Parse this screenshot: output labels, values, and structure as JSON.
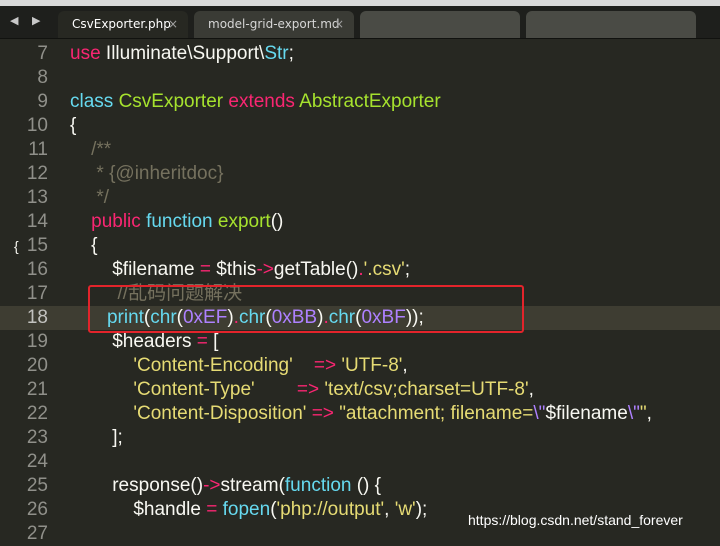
{
  "tabs": [
    {
      "label": "CsvExporter.php",
      "close": "×",
      "active": true
    },
    {
      "label": "model-grid-export.md",
      "close": "×",
      "active": false
    }
  ],
  "nav_arrows": "◀ ▶",
  "fold_marker": "{",
  "watermark": "https://blog.csdn.net/stand_forever",
  "current_line": "18",
  "lines": [
    {
      "n": "7",
      "tokens": [
        {
          "t": "use",
          "c": "kw"
        },
        {
          "t": " Illuminate\\Support\\",
          "c": "var"
        },
        {
          "t": "Str",
          "c": "st"
        },
        {
          "t": ";",
          "c": "var"
        }
      ]
    },
    {
      "n": "8",
      "tokens": []
    },
    {
      "n": "9",
      "tokens": [
        {
          "t": "class",
          "c": "st"
        },
        {
          "t": " ",
          "c": "var"
        },
        {
          "t": "CsvExporter",
          "c": "cls"
        },
        {
          "t": " ",
          "c": "var"
        },
        {
          "t": "extends",
          "c": "kw"
        },
        {
          "t": " ",
          "c": "var"
        },
        {
          "t": "AbstractExporter",
          "c": "cls"
        }
      ]
    },
    {
      "n": "10",
      "tokens": [
        {
          "t": "{",
          "c": "var"
        }
      ]
    },
    {
      "n": "11",
      "tokens": [
        {
          "t": "    /**",
          "c": "cm"
        }
      ]
    },
    {
      "n": "12",
      "tokens": [
        {
          "t": "     * {@inheritdoc}",
          "c": "cm"
        }
      ]
    },
    {
      "n": "13",
      "tokens": [
        {
          "t": "     */",
          "c": "cm"
        }
      ]
    },
    {
      "n": "14",
      "tokens": [
        {
          "t": "    ",
          "c": "var"
        },
        {
          "t": "public",
          "c": "kw"
        },
        {
          "t": " ",
          "c": "var"
        },
        {
          "t": "function",
          "c": "st"
        },
        {
          "t": " ",
          "c": "var"
        },
        {
          "t": "export",
          "c": "fn"
        },
        {
          "t": "()",
          "c": "var"
        }
      ]
    },
    {
      "n": "15",
      "tokens": [
        {
          "t": "    {",
          "c": "var"
        }
      ],
      "fold": true
    },
    {
      "n": "16",
      "tokens": [
        {
          "t": "        $filename ",
          "c": "var"
        },
        {
          "t": "=",
          "c": "op"
        },
        {
          "t": " $this",
          "c": "var"
        },
        {
          "t": "->",
          "c": "op"
        },
        {
          "t": "getTable",
          "c": "var"
        },
        {
          "t": "()",
          "c": "var"
        },
        {
          "t": ".",
          "c": "op"
        },
        {
          "t": "'.csv'",
          "c": "str"
        },
        {
          "t": ";",
          "c": "var"
        }
      ]
    },
    {
      "n": "17",
      "tokens": [
        {
          "t": "         //乱码问题解决",
          "c": "cm"
        }
      ]
    },
    {
      "n": "18",
      "tokens": [
        {
          "t": "       ",
          "c": "var"
        },
        {
          "t": "print",
          "c": "st"
        },
        {
          "t": "(",
          "c": "var"
        },
        {
          "t": "chr",
          "c": "st"
        },
        {
          "t": "(",
          "c": "var"
        },
        {
          "t": "0xEF",
          "c": "num"
        },
        {
          "t": ")",
          "c": "var"
        },
        {
          "t": ".",
          "c": "op"
        },
        {
          "t": "chr",
          "c": "st"
        },
        {
          "t": "(",
          "c": "var"
        },
        {
          "t": "0xBB",
          "c": "num"
        },
        {
          "t": ")",
          "c": "var"
        },
        {
          "t": ".",
          "c": "op"
        },
        {
          "t": "chr",
          "c": "st"
        },
        {
          "t": "(",
          "c": "var"
        },
        {
          "t": "0xBF",
          "c": "num"
        },
        {
          "t": "));",
          "c": "var"
        }
      ]
    },
    {
      "n": "19",
      "tokens": [
        {
          "t": "        $headers ",
          "c": "var"
        },
        {
          "t": "=",
          "c": "op"
        },
        {
          "t": " [",
          "c": "var"
        }
      ]
    },
    {
      "n": "20",
      "tokens": [
        {
          "t": "            ",
          "c": "var"
        },
        {
          "t": "'Content-Encoding'",
          "c": "str"
        },
        {
          "t": "    ",
          "c": "var"
        },
        {
          "t": "=>",
          "c": "op"
        },
        {
          "t": " ",
          "c": "var"
        },
        {
          "t": "'UTF-8'",
          "c": "str"
        },
        {
          "t": ",",
          "c": "var"
        }
      ]
    },
    {
      "n": "21",
      "tokens": [
        {
          "t": "            ",
          "c": "var"
        },
        {
          "t": "'Content-Type'",
          "c": "str"
        },
        {
          "t": "        ",
          "c": "var"
        },
        {
          "t": "=>",
          "c": "op"
        },
        {
          "t": " ",
          "c": "var"
        },
        {
          "t": "'text/csv;charset=UTF-8'",
          "c": "str"
        },
        {
          "t": ",",
          "c": "var"
        }
      ]
    },
    {
      "n": "22",
      "tokens": [
        {
          "t": "            ",
          "c": "var"
        },
        {
          "t": "'Content-Disposition'",
          "c": "str"
        },
        {
          "t": " ",
          "c": "var"
        },
        {
          "t": "=>",
          "c": "op"
        },
        {
          "t": " ",
          "c": "var"
        },
        {
          "t": "\"attachment; filename=",
          "c": "str"
        },
        {
          "t": "\\\"",
          "c": "esc"
        },
        {
          "t": "$filename",
          "c": "var"
        },
        {
          "t": "\\\"",
          "c": "esc"
        },
        {
          "t": "\"",
          "c": "str"
        },
        {
          "t": ",",
          "c": "var"
        }
      ]
    },
    {
      "n": "23",
      "tokens": [
        {
          "t": "        ];",
          "c": "var"
        }
      ]
    },
    {
      "n": "24",
      "tokens": []
    },
    {
      "n": "25",
      "tokens": [
        {
          "t": "        response",
          "c": "var"
        },
        {
          "t": "()",
          "c": "var"
        },
        {
          "t": "->",
          "c": "op"
        },
        {
          "t": "stream",
          "c": "var"
        },
        {
          "t": "(",
          "c": "var"
        },
        {
          "t": "function",
          "c": "st"
        },
        {
          "t": " () {",
          "c": "var"
        }
      ]
    },
    {
      "n": "26",
      "tokens": [
        {
          "t": "            $handle ",
          "c": "var"
        },
        {
          "t": "=",
          "c": "op"
        },
        {
          "t": " ",
          "c": "var"
        },
        {
          "t": "fopen",
          "c": "st"
        },
        {
          "t": "(",
          "c": "var"
        },
        {
          "t": "'php://output'",
          "c": "str"
        },
        {
          "t": ", ",
          "c": "var"
        },
        {
          "t": "'w'",
          "c": "str"
        },
        {
          "t": ");",
          "c": "var"
        }
      ]
    },
    {
      "n": "27",
      "tokens": []
    }
  ]
}
